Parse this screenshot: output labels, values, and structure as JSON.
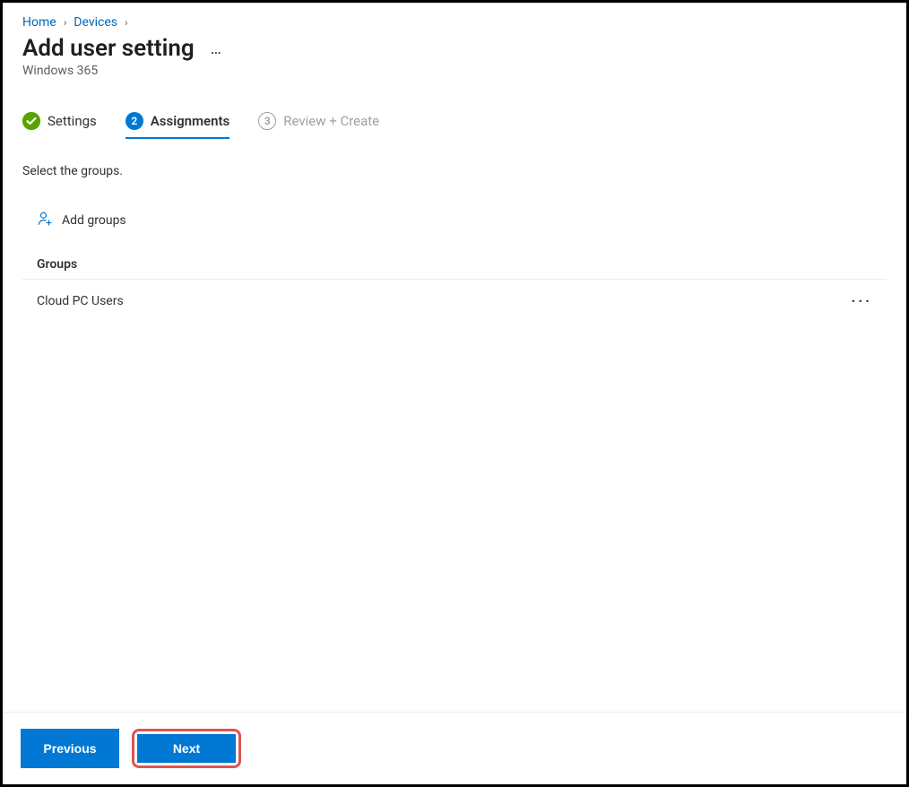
{
  "breadcrumb": {
    "home": "Home",
    "devices": "Devices"
  },
  "page": {
    "title": "Add user setting",
    "subtitle": "Windows 365"
  },
  "tabs": {
    "settings": {
      "num": "",
      "label": "Settings"
    },
    "assignments": {
      "num": "2",
      "label": "Assignments"
    },
    "review": {
      "num": "3",
      "label": "Review + Create"
    }
  },
  "instruction": "Select the groups.",
  "addGroupsLabel": "Add groups",
  "groupsHeader": "Groups",
  "groups": [
    {
      "name": "Cloud PC Users"
    }
  ],
  "footer": {
    "previous": "Previous",
    "next": "Next"
  }
}
